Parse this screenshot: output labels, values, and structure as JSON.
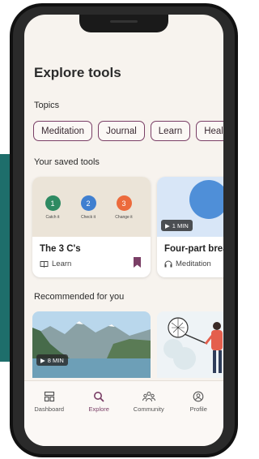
{
  "screen": {
    "title": "Explore tools"
  },
  "topics": {
    "label": "Topics",
    "chips": [
      "Meditation",
      "Journal",
      "Learn",
      "Heal"
    ]
  },
  "saved": {
    "label": "Your saved tools",
    "cards": [
      {
        "title": "The 3 C's",
        "category": "Learn",
        "icon": "book-icon",
        "steps": [
          {
            "num": "1",
            "label": "Catch it",
            "color": "#2e8a62"
          },
          {
            "num": "2",
            "label": "Check it",
            "color": "#3f7fd0"
          },
          {
            "num": "3",
            "label": "Change it",
            "color": "#ec6a3c"
          }
        ],
        "bookmark_color": "#7a3f66"
      },
      {
        "title": "Four-part breath",
        "category": "Meditation",
        "icon": "headphones-icon",
        "duration": "1 MIN"
      }
    ]
  },
  "recommended": {
    "label": "Recommended for you",
    "cards": [
      {
        "duration": "8 MIN",
        "image": "mountain-lake"
      },
      {
        "image": "person-with-net"
      }
    ]
  },
  "nav": {
    "items": [
      {
        "label": "Dashboard",
        "icon": "dashboard-icon",
        "active": false
      },
      {
        "label": "Explore",
        "icon": "search-icon",
        "active": true
      },
      {
        "label": "Community",
        "icon": "community-icon",
        "active": false
      },
      {
        "label": "Profile",
        "icon": "profile-icon",
        "active": false
      }
    ]
  },
  "colors": {
    "accent": "#7a3f66",
    "background": "#f7f3ee",
    "side_panel": "#1e6e6b"
  }
}
